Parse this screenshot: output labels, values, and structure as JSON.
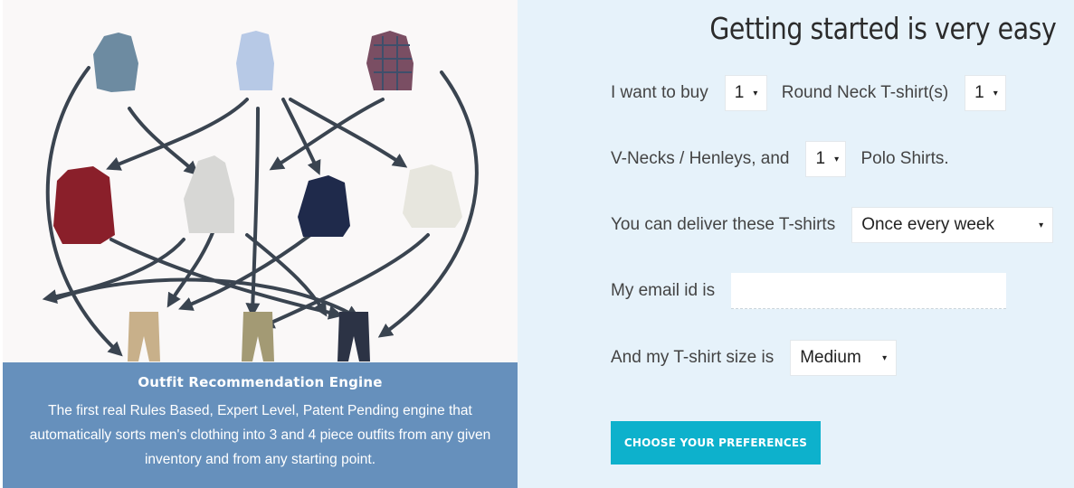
{
  "left": {
    "caption_title": "Outfit Recommendation Engine",
    "caption_text": "The first real Rules Based, Expert Level, Patent Pending engine that automatically sorts men's clothing into 3 and 4 piece outfits from any given inventory and from any starting point."
  },
  "form": {
    "heading": "Getting started is very easy",
    "row1_prefix": "I want to buy",
    "qty_round_neck": "1",
    "row1_label": "Round Neck T-shirt(s)",
    "qty_vneck": "1",
    "row2_prefix": "V-Necks / Henleys, and",
    "qty_polo": "1",
    "row2_label": "Polo Shirts.",
    "row3_prefix": "You can deliver these T-shirts",
    "delivery_frequency": "Once every week",
    "row4_prefix": "My email id is",
    "email_value": "",
    "row5_prefix": "And my T-shirt size is",
    "size": "Medium",
    "submit_label": "CHOOSE YOUR PREFERENCES"
  },
  "colors": {
    "caption_bg": "#6690bc",
    "form_bg": "#e6f2fa",
    "button_bg": "#0db1cc"
  }
}
